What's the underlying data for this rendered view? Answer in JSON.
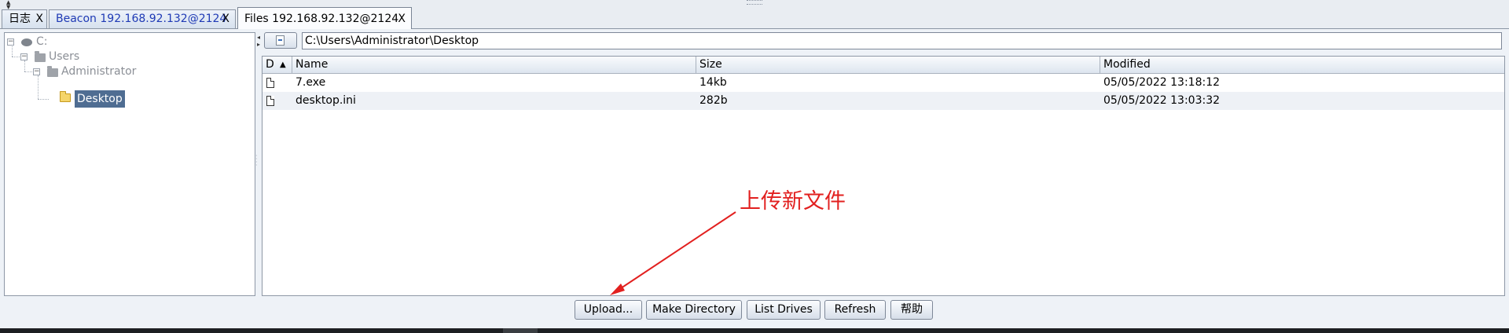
{
  "tabs": [
    {
      "label": "日志",
      "close": "X"
    },
    {
      "label": "Beacon 192.168.92.132@2124",
      "close": "X"
    },
    {
      "label": "Files 192.168.92.132@2124",
      "close": "X"
    }
  ],
  "tree": {
    "drive": "C:",
    "users": "Users",
    "administrator": "Administrator",
    "desktop": "Desktop"
  },
  "path": {
    "value": "C:\\Users\\Administrator\\Desktop"
  },
  "table": {
    "columns": {
      "d": "D",
      "name": "Name",
      "size": "Size",
      "modified": "Modified"
    },
    "rows": [
      {
        "name": "7.exe",
        "size": "14kb",
        "modified": "05/05/2022 13:18:12"
      },
      {
        "name": "desktop.ini",
        "size": "282b",
        "modified": "05/05/2022 13:03:32"
      }
    ]
  },
  "annotation": {
    "text": "上传新文件",
    "color": "#e2201f"
  },
  "buttons": {
    "upload": "Upload...",
    "make_directory": "Make Directory",
    "list_drives": "List Drives",
    "refresh": "Refresh",
    "help": "帮助"
  },
  "icons": [
    "drive-icon",
    "folder-icon",
    "file-icon",
    "up-folder-icon",
    "sort-ascending-icon"
  ]
}
